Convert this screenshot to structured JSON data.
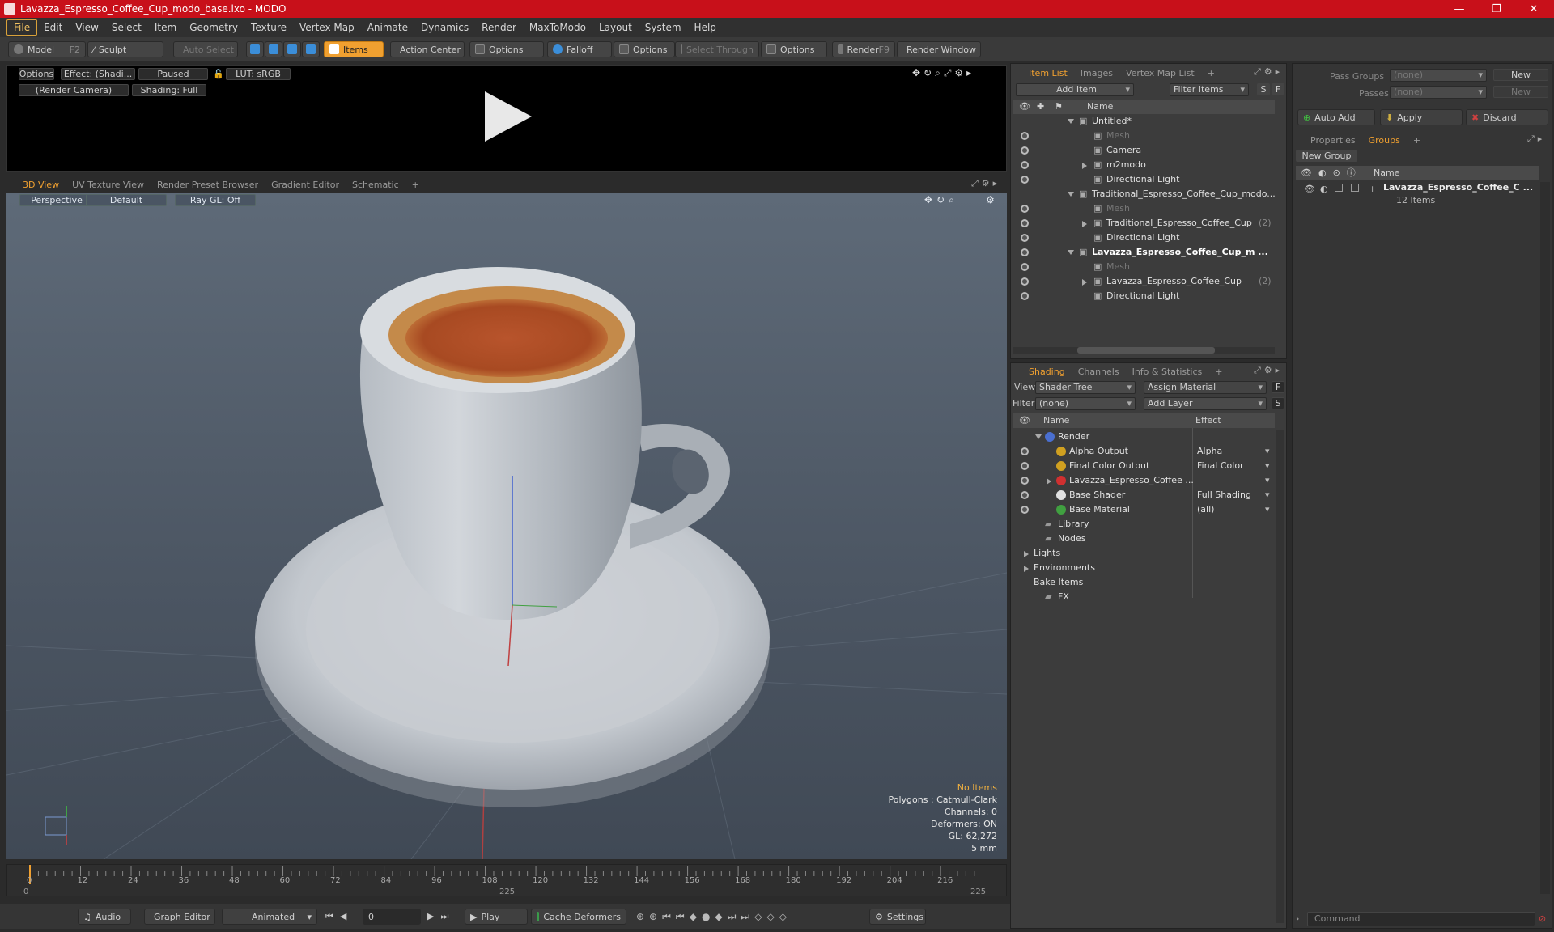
{
  "window": {
    "title": "Lavazza_Espresso_Coffee_Cup_modo_base.lxo - MODO",
    "min": "—",
    "max": "❐",
    "close": "✕"
  },
  "menu": [
    "File",
    "Edit",
    "View",
    "Select",
    "Item",
    "Geometry",
    "Texture",
    "Vertex Map",
    "Animate",
    "Dynamics",
    "Render",
    "MaxToModo",
    "Layout",
    "System",
    "Help"
  ],
  "toolbar": {
    "model": "Model",
    "model_key": "F2",
    "sculpt": "Sculpt",
    "auto_select": "Auto Select",
    "items": "Items",
    "action_center": "Action Center",
    "options1": "Options",
    "falloff": "Falloff",
    "options2": "Options",
    "select_through": "Select Through",
    "options3": "Options",
    "render": "Render",
    "render_key": "F9",
    "render_window": "Render Window"
  },
  "preview": {
    "options": "Options",
    "effect": "Effect: (Shadi...",
    "paused": "Paused",
    "lut": "LUT: sRGB",
    "camera": "(Render Camera)",
    "shading": "Shading: Full"
  },
  "view_tabs": [
    "3D View",
    "UV Texture View",
    "Render Preset Browser",
    "Gradient Editor",
    "Schematic",
    "+"
  ],
  "viewport": {
    "perspective": "Perspective",
    "default": "Default",
    "raygl": "Ray GL: Off",
    "info": [
      "No Items",
      "Polygons : Catmull-Clark",
      "Channels: 0",
      "Deformers: ON",
      "GL: 62,272",
      "5 mm"
    ]
  },
  "timeline": {
    "ticks": [
      "0",
      "12",
      "24",
      "36",
      "48",
      "60",
      "72",
      "84",
      "96",
      "108",
      "120",
      "132",
      "144",
      "156",
      "168",
      "180",
      "192",
      "204",
      "216"
    ],
    "start": "0",
    "mid": "225",
    "end": "225"
  },
  "bottom": {
    "audio": "Audio",
    "graph_editor": "Graph Editor",
    "animated": "Animated",
    "frame": "0",
    "play": "Play",
    "cache": "Cache Deformers",
    "settings": "Settings"
  },
  "item_list": {
    "tabs": [
      "Item List",
      "Images",
      "Vertex Map List",
      "+"
    ],
    "add_item": "Add Item",
    "filter": "Filter Items",
    "s": "S",
    "f": "F",
    "col_name": "Name",
    "rows": [
      {
        "label": "Untitled*",
        "indent": 0,
        "tri": "down",
        "dim": false,
        "bold": false,
        "eye": false
      },
      {
        "label": "Mesh",
        "indent": 1,
        "tri": "",
        "dim": true,
        "bold": false,
        "eye": true
      },
      {
        "label": "Camera",
        "indent": 1,
        "tri": "",
        "dim": false,
        "bold": false,
        "eye": true
      },
      {
        "label": "m2modo",
        "indent": 1,
        "tri": "right",
        "dim": false,
        "bold": false,
        "eye": true
      },
      {
        "label": "Directional Light",
        "indent": 1,
        "tri": "",
        "dim": false,
        "bold": false,
        "eye": true
      },
      {
        "label": "Traditional_Espresso_Coffee_Cup_modo...",
        "indent": 0,
        "tri": "down",
        "dim": false,
        "bold": false,
        "eye": false
      },
      {
        "label": "Mesh",
        "indent": 1,
        "tri": "",
        "dim": true,
        "bold": false,
        "eye": true
      },
      {
        "label": "Traditional_Espresso_Coffee_Cup",
        "indent": 1,
        "tri": "right",
        "dim": false,
        "bold": false,
        "eye": true,
        "suffix": "(2)"
      },
      {
        "label": "Directional Light",
        "indent": 1,
        "tri": "",
        "dim": false,
        "bold": false,
        "eye": true
      },
      {
        "label": "Lavazza_Espresso_Coffee_Cup_m ...",
        "indent": 0,
        "tri": "down",
        "dim": false,
        "bold": true,
        "eye": true
      },
      {
        "label": "Mesh",
        "indent": 1,
        "tri": "",
        "dim": true,
        "bold": false,
        "eye": true
      },
      {
        "label": "Lavazza_Espresso_Coffee_Cup",
        "indent": 1,
        "tri": "right",
        "dim": false,
        "bold": false,
        "eye": true,
        "suffix": "(2)"
      },
      {
        "label": "Directional Light",
        "indent": 1,
        "tri": "",
        "dim": false,
        "bold": false,
        "eye": true
      }
    ]
  },
  "shading": {
    "tabs": [
      "Shading",
      "Channels",
      "Info & Statistics",
      "+"
    ],
    "view_label": "View",
    "view_value": "Shader Tree",
    "assign": "Assign Material",
    "f": "F",
    "filter_label": "Filter",
    "filter_value": "(none)",
    "add_layer": "Add Layer",
    "s": "S",
    "col_name": "Name",
    "col_effect": "Effect",
    "rows": [
      {
        "label": "Render",
        "effect": "",
        "color": "#4a6fd0",
        "indent": 0,
        "tri": "down",
        "eye": false
      },
      {
        "label": "Alpha Output",
        "effect": "Alpha",
        "color": "#d0a020",
        "indent": 1,
        "tri": "",
        "eye": true
      },
      {
        "label": "Final Color Output",
        "effect": "Final Color",
        "color": "#d0a020",
        "indent": 1,
        "tri": "",
        "eye": true
      },
      {
        "label": "Lavazza_Espresso_Coffee ...",
        "effect": "",
        "color": "#d03030",
        "indent": 1,
        "tri": "right",
        "eye": true
      },
      {
        "label": "Base Shader",
        "effect": "Full Shading",
        "color": "#e0e0e0",
        "indent": 1,
        "tri": "",
        "eye": true
      },
      {
        "label": "Base Material",
        "effect": "(all)",
        "color": "#40a040",
        "indent": 1,
        "tri": "",
        "eye": true
      },
      {
        "label": "Library",
        "effect": "",
        "color": "",
        "indent": 0,
        "tri": "",
        "eye": false
      },
      {
        "label": "Nodes",
        "effect": "",
        "color": "",
        "indent": 0,
        "tri": "",
        "eye": false
      },
      {
        "label": "Lights",
        "effect": "",
        "color": "",
        "indent": -1,
        "tri": "right",
        "eye": false
      },
      {
        "label": "Environments",
        "effect": "",
        "color": "",
        "indent": -1,
        "tri": "right",
        "eye": false
      },
      {
        "label": "Bake Items",
        "effect": "",
        "color": "",
        "indent": -1,
        "tri": "",
        "eye": false
      },
      {
        "label": "FX",
        "effect": "",
        "color": "",
        "indent": 0,
        "tri": "",
        "eye": false
      }
    ]
  },
  "right": {
    "pass_groups": "Pass Groups",
    "passes": "Passes",
    "none1": "(none)",
    "none2": "(none)",
    "new1": "New",
    "new2": "New",
    "auto_add": "Auto Add",
    "apply": "Apply",
    "discard": "Discard",
    "tabs": [
      "Properties",
      "Groups",
      "+"
    ],
    "new_group": "New Group",
    "col_name": "Name",
    "group_name": "Lavazza_Espresso_Coffee_C ...",
    "group_count": "12 Items",
    "command": "Command"
  },
  "colors": {
    "accent": "#f0a030",
    "title": "#c8101a"
  }
}
